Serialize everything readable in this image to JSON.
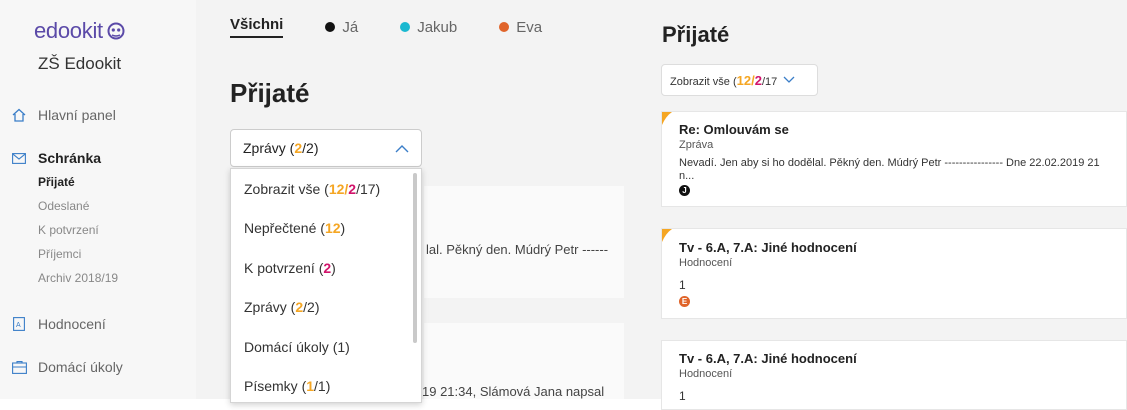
{
  "sidebar": {
    "logo": "edookit",
    "school": "ZŠ Edookit",
    "nav": [
      {
        "label": "Hlavní panel",
        "icon": "home-icon"
      },
      {
        "label": "Schránka",
        "icon": "envelope-icon"
      },
      {
        "label": "Hodnocení",
        "icon": "grade-icon"
      },
      {
        "label": "Domácí úkoly",
        "icon": "homework-icon"
      }
    ],
    "sub": [
      "Přijaté",
      "Odeslané",
      "K potvrzení",
      "Příjemci",
      "Archiv 2018/19"
    ]
  },
  "middle": {
    "tabs": [
      {
        "label": "Všichni",
        "color": ""
      },
      {
        "label": "Já",
        "color": "#111111"
      },
      {
        "label": "Jakub",
        "color": "#1ab8d0"
      },
      {
        "label": "Eva",
        "color": "#e0642a"
      }
    ],
    "title": "Přijaté",
    "select": {
      "label": "Zprávy (",
      "a": "2",
      "b": "/2)"
    },
    "snippet1": "lal. Pěkný den. Múdrý Petr ------",
    "snippet2": "19 21:34, Slámová Jana napsal"
  },
  "dropdown": {
    "items": [
      {
        "pre": "Zobrazit vše (",
        "y": "12",
        "sep": "/",
        "m": "2",
        "post": "/17)"
      },
      {
        "pre": "Nepřečtené (",
        "y": "12",
        "post": ")"
      },
      {
        "pre": "K potvrzení (",
        "m": "2",
        "post": ")"
      },
      {
        "pre": "Zprávy (",
        "y": "2",
        "post": "/2)"
      },
      {
        "pre": "Domácí úkoly (1)"
      },
      {
        "pre": "Písemky (",
        "y": "1",
        "post": "/1)"
      }
    ]
  },
  "right": {
    "title": "Přijaté",
    "select": {
      "pre": "Zobrazit vše (",
      "y": "12",
      "sep": "/",
      "m": "2",
      "post": "/17"
    },
    "cards": [
      {
        "title": "Re: Omlouvám se",
        "type": "Zpráva",
        "text": "Nevadí. Jen aby si ho dodělal. Pěkný den. Múdrý Petr ---------------- Dne 22.02.2019 21",
        "text2": "n...",
        "badge": "J",
        "badge_color": "#111111"
      },
      {
        "title": "Tv - 6.A, 7.A: Jiné hodnocení",
        "type": "Hodnocení",
        "text": "1",
        "badge": "E",
        "badge_color": "#e0642a"
      },
      {
        "title": "Tv - 6.A, 7.A: Jiné hodnocení",
        "type": "Hodnocení",
        "text": "1"
      }
    ]
  },
  "colors": {
    "accent_yellow": "#f5a623",
    "accent_magenta": "#d1146b",
    "brand": "#5b4aa8"
  }
}
